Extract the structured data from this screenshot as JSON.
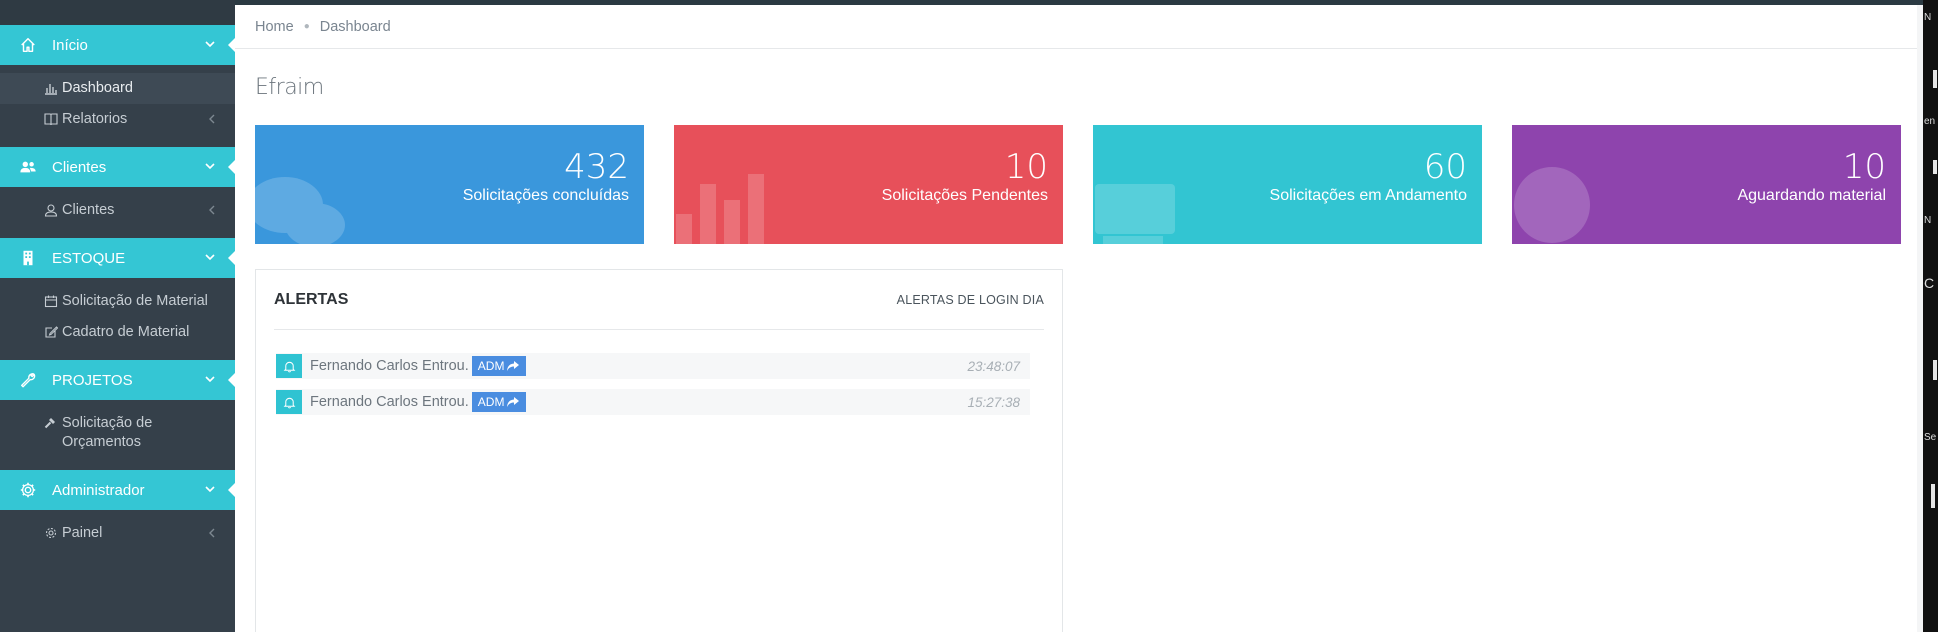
{
  "sidebar": {
    "sections": [
      {
        "label": "Início",
        "icon": "home-icon",
        "items": [
          {
            "label": "Dashboard",
            "icon": "bar-chart-icon",
            "active": true
          },
          {
            "label": "Relatorios",
            "icon": "book-icon",
            "expandable": true
          }
        ]
      },
      {
        "label": "Clientes",
        "icon": "users-icon",
        "items": [
          {
            "label": "Clientes",
            "icon": "user-icon",
            "expandable": true
          }
        ]
      },
      {
        "label": "ESTOQUE",
        "icon": "building-icon",
        "items": [
          {
            "label": "Solicitação de Material",
            "icon": "calendar-icon"
          },
          {
            "label": "Cadatro de Material",
            "icon": "edit-icon"
          }
        ]
      },
      {
        "label": "PROJETOS",
        "icon": "wrench-icon",
        "items": [
          {
            "label": "Solicitação de Orçamentos",
            "icon": "gavel-icon"
          }
        ]
      },
      {
        "label": "Administrador",
        "icon": "gear-icon",
        "items": [
          {
            "label": "Painel",
            "icon": "cog-icon",
            "expandable": true
          }
        ]
      }
    ]
  },
  "breadcrumb": {
    "home": "Home",
    "current": "Dashboard"
  },
  "page": {
    "title": "Efraim"
  },
  "stats": [
    {
      "value": "432",
      "label": "Solicitações concluídas",
      "color": "#3a97dc"
    },
    {
      "value": "10",
      "label": "Solicitações Pendentes",
      "color": "#e7505a"
    },
    {
      "value": "60",
      "label": "Solicitações em Andamento",
      "color": "#32c5d2"
    },
    {
      "value": "10",
      "label": "Aguardando material",
      "color": "#8e44ad"
    }
  ],
  "alerts": {
    "title": "ALERTAS",
    "link": "ALERTAS DE LOGIN DIA",
    "rows": [
      {
        "message": "Fernando Carlos Entrou.",
        "tag": "ADM",
        "time": "23:48:07"
      },
      {
        "message": "Fernando Carlos Entrou.",
        "tag": "ADM",
        "time": "15:27:38"
      }
    ]
  },
  "desktop_strip": {
    "texts": [
      "N",
      "en",
      "N",
      "C",
      "Se"
    ]
  }
}
